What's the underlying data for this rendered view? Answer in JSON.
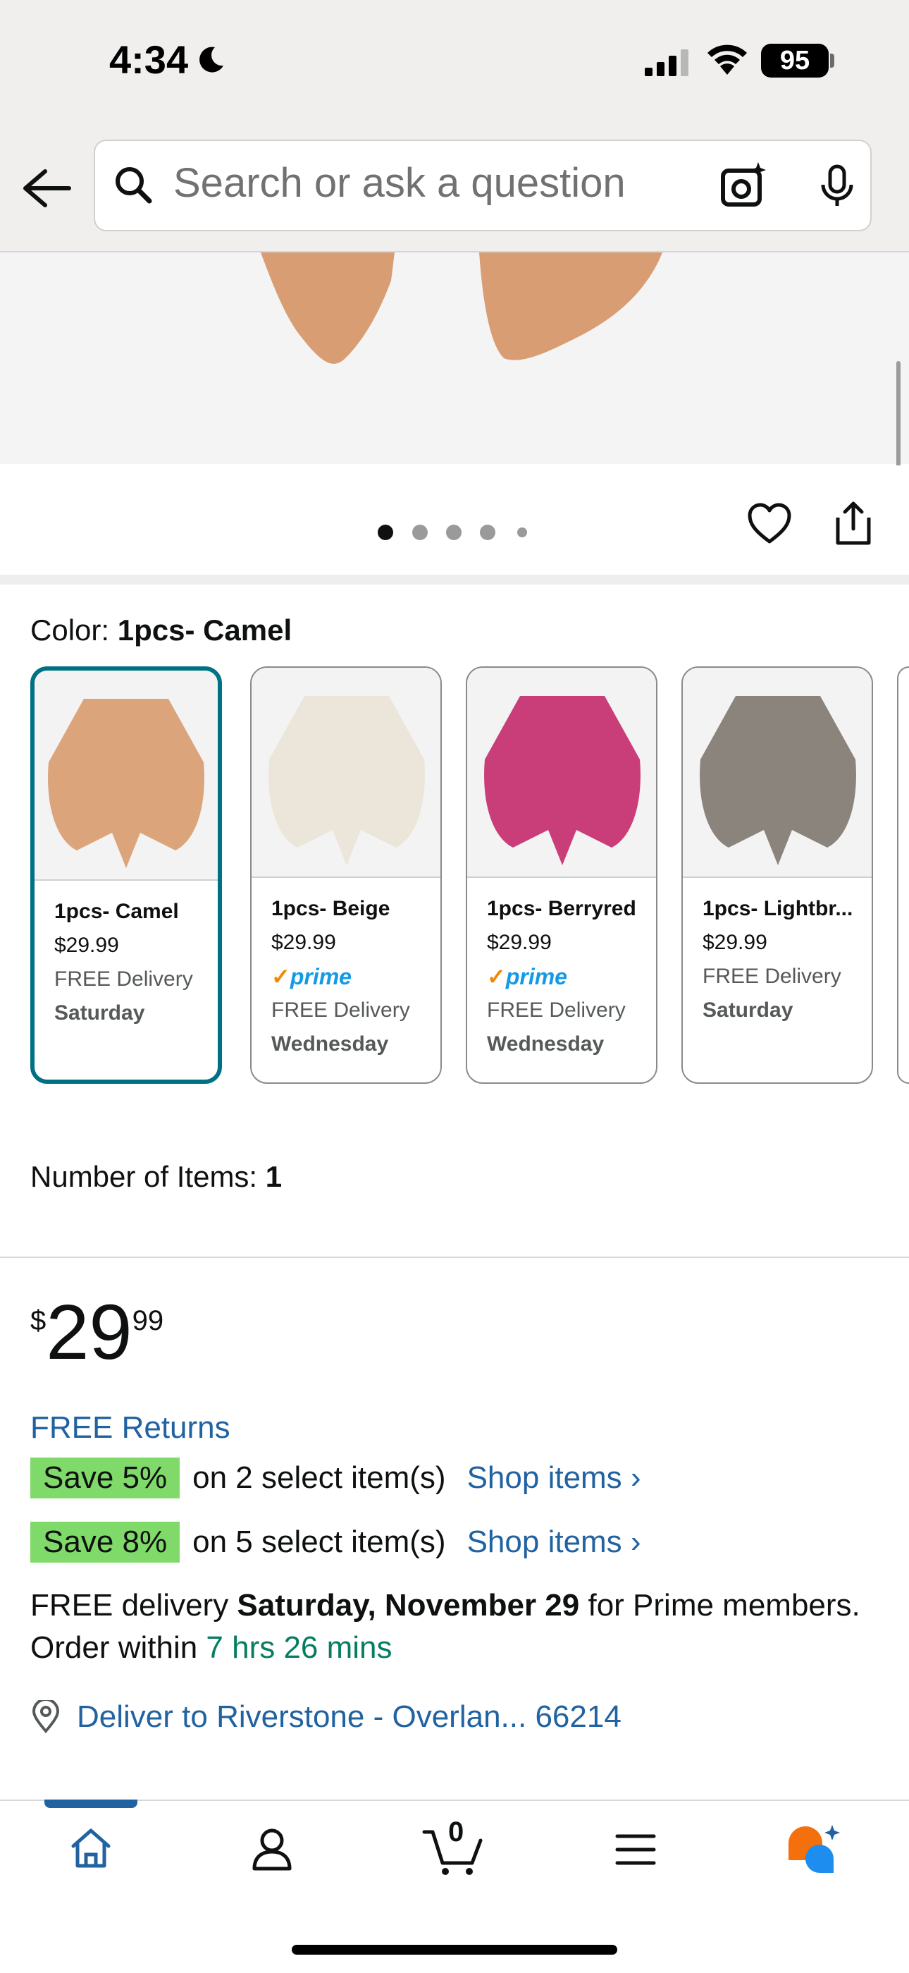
{
  "status_bar": {
    "time": "4:34",
    "battery": "95"
  },
  "search": {
    "placeholder": "Search or ask a question"
  },
  "image_dots": {
    "count": 5,
    "active": 0
  },
  "color": {
    "label": "Color:",
    "value": "1pcs- Camel"
  },
  "swatches": [
    {
      "name": "1pcs- Camel",
      "price": "$29.99",
      "delivery": "FREE Delivery",
      "day": "Saturday",
      "prime": false,
      "color": "#dba47b",
      "selected": true
    },
    {
      "name": "1pcs- Beige",
      "price": "$29.99",
      "prime_label": "prime",
      "delivery": "FREE Delivery",
      "day": "Wednesday",
      "prime": true,
      "color": "#ece5da"
    },
    {
      "name": "1pcs- Berryred",
      "price": "$29.99",
      "prime_label": "prime",
      "delivery": "FREE Delivery",
      "day": "Wednesday",
      "prime": true,
      "color": "#c93d79"
    },
    {
      "name": "1pcs- Lightbr...",
      "price": "$29.99",
      "delivery": "FREE Delivery",
      "day": "Saturday",
      "prime": false,
      "color": "#8a847c"
    }
  ],
  "number_of_items": {
    "label": "Number of Items:",
    "value": "1"
  },
  "price": {
    "symbol": "$",
    "whole": "29",
    "fraction": "99"
  },
  "returns": "FREE Returns",
  "promos": [
    {
      "badge": "Save 5%",
      "text": "on 2 select item(s)",
      "link": "Shop items ›"
    },
    {
      "badge": "Save 8%",
      "text": "on 5 select item(s)",
      "link": "Shop items ›"
    }
  ],
  "delivery": {
    "prefix": "FREE delivery ",
    "date": "Saturday, November 29",
    "middle": " for Prime members. Order within ",
    "countdown": "7 hrs 26 mins"
  },
  "location": {
    "text": "Deliver to Riverstone - Overlan... 66214"
  },
  "nav": {
    "cart_count": "0"
  },
  "colors": {
    "link": "#2162a1",
    "selected_border": "#007185",
    "promo_badge": "#7fda69",
    "countdown": "#067d62"
  }
}
